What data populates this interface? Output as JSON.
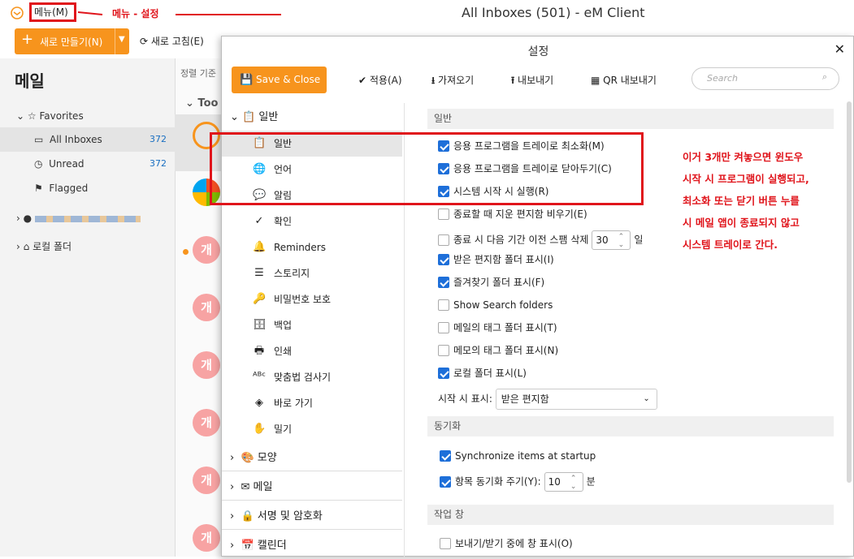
{
  "window": {
    "title": "All Inboxes (501) - eM Client",
    "menu_label": "메뉴(M)",
    "menu_annotation": "메뉴 - 설정"
  },
  "toolbar": {
    "new_label": "새로 만들기(N)",
    "refresh_label": "새로 고침(E)"
  },
  "sidebar": {
    "heading": "메일",
    "favorites": "Favorites",
    "items": [
      {
        "label": "All Inboxes",
        "count": "372"
      },
      {
        "label": "Unread",
        "count": "372"
      },
      {
        "label": "Flagged",
        "count": ""
      }
    ],
    "local_folder": "로컬 폴더"
  },
  "mail_list": {
    "sort_label": "정렬 기준",
    "group_label": "Too",
    "avatar_letter": "개"
  },
  "dialog": {
    "title": "설정",
    "save_close": "Save & Close",
    "apply": "적용(A)",
    "import": "가져오기",
    "export": "내보내기",
    "qr_export": "QR 내보내기",
    "search_placeholder": "Search",
    "nav": {
      "general_cat": "일반",
      "sub": [
        "일반",
        "언어",
        "알림",
        "확인",
        "Reminders",
        "스토리지",
        "비밀번호 보호",
        "백업",
        "인쇄",
        "맞춤법 검사기",
        "바로 가기",
        "밀기"
      ],
      "cats": [
        "모양",
        "메일",
        "서명 및 암호화",
        "캘린더"
      ]
    },
    "sections": {
      "general": "일반",
      "sync": "동기화",
      "workpane": "작업 창"
    },
    "options": [
      {
        "label": "응용 프로그램을 트레이로 최소화(M)",
        "checked": true
      },
      {
        "label": "응용 프로그램을 트레이로 닫아두기(C)",
        "checked": true
      },
      {
        "label": "시스템 시작 시 실행(R)",
        "checked": true
      },
      {
        "label": "종료할 때 지운 편지함 비우기(E)",
        "checked": false
      },
      {
        "label": "종료 시 다음 기간 이전 스팸 삭제",
        "checked": false,
        "value": "30",
        "unit": "일"
      },
      {
        "label": "받은 편지함 폴더 표시(I)",
        "checked": true
      },
      {
        "label": "즐겨찾기 폴더 표시(F)",
        "checked": true
      },
      {
        "label": "Show Search folders",
        "checked": false
      },
      {
        "label": "메일의 태그 폴더 표시(T)",
        "checked": false
      },
      {
        "label": "메모의 태그 폴더 표시(N)",
        "checked": false
      },
      {
        "label": "로컬 폴더 표시(L)",
        "checked": true
      }
    ],
    "startup_label": "시작 시 표시:",
    "startup_value": "받은 편지함",
    "sync_options": [
      {
        "label": "Synchronize items at startup",
        "checked": true
      },
      {
        "label": "항목 동기화 주기(Y):",
        "checked": true,
        "value": "10",
        "unit": "분"
      }
    ],
    "workpane_options": [
      {
        "label": "보내기/받기 중에 창 표시(O)",
        "checked": false
      }
    ]
  },
  "annotation_note": [
    "이거 3개만 켜놓으면 윈도우",
    "시작 시 프로그램이 실행되고,",
    "최소화 또는 닫기 버튼 누를",
    "시 메일 앱이 종료되지 않고",
    "시스템 트레이로 간다."
  ]
}
